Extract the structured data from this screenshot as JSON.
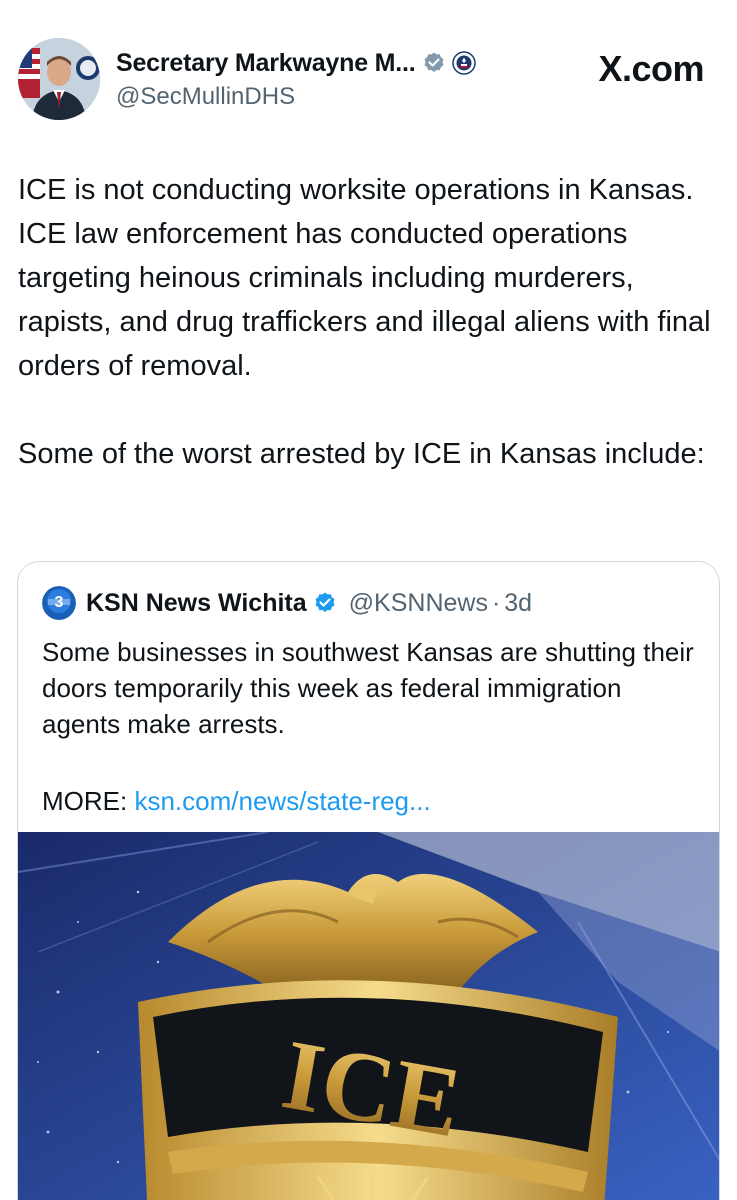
{
  "author": {
    "display_name": "Secretary Markwayne M...",
    "handle": "@SecMullinDHS"
  },
  "brand": "X.com",
  "post": {
    "paragraph1": "ICE is not conducting worksite operations in Kansas. ICE law enforcement has conducted operations targeting heinous criminals including murderers, rapists, and drug traffickers and illegal aliens with final orders of removal.",
    "paragraph2": "Some of the worst arrested by ICE in Kansas include:"
  },
  "quoted": {
    "display_name": "KSN News Wichita",
    "handle": "@KSNNews",
    "separator": "·",
    "time": "3d",
    "text": "Some businesses in southwest Kansas are shutting their doors temporarily this week as federal immigration agents make arrests.",
    "more_label": "MORE:",
    "link": "ksn.com/news/state-reg...",
    "avatar_badge": "3",
    "image_lettering": "ICE"
  },
  "colors": {
    "verified_badge": "#1d9bf0",
    "gray_badge": "#829aab",
    "link": "#1d9bf0",
    "secondary_text": "#536471"
  },
  "icons": {
    "verified": "verified-badge-icon",
    "gov": "gray-verified-badge-icon",
    "affiliation": "dhs-seal-icon",
    "brand": "x-logo"
  }
}
